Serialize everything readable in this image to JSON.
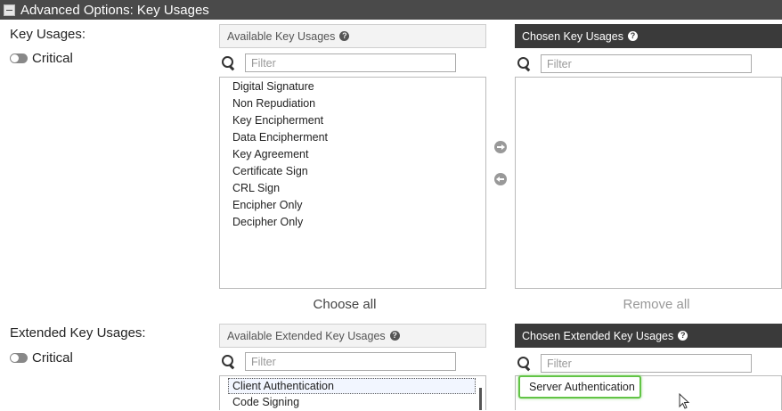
{
  "section": {
    "title": "Advanced Options: Key Usages",
    "collapse_icon": "minus-square-icon"
  },
  "key_usages": {
    "label": "Key Usages:",
    "critical_label": "Critical",
    "critical_on": false,
    "available": {
      "header": "Available Key Usages",
      "help_glyph": "?",
      "filter_placeholder": "Filter",
      "items": [
        "Digital Signature",
        "Non Repudiation",
        "Key Encipherment",
        "Data Encipherment",
        "Key Agreement",
        "Certificate Sign",
        "CRL Sign",
        "Encipher Only",
        "Decipher Only"
      ],
      "action": "Choose all"
    },
    "chosen": {
      "header": "Chosen Key Usages",
      "help_glyph": "?",
      "filter_placeholder": "Filter",
      "items": [],
      "action": "Remove all"
    }
  },
  "extended_key_usages": {
    "label": "Extended Key Usages:",
    "critical_label": "Critical",
    "critical_on": false,
    "available": {
      "header": "Available Extended Key Usages",
      "help_glyph": "?",
      "filter_placeholder": "Filter",
      "items": [
        "Client Authentication",
        "Code Signing"
      ]
    },
    "chosen": {
      "header": "Chosen Extended Key Usages",
      "help_glyph": "?",
      "filter_placeholder": "Filter",
      "items": [
        "Server Authentication"
      ]
    }
  },
  "colors": {
    "header_bg": "#4a4a4a",
    "dark_panel": "#3a3a3a",
    "highlight": "#62c446"
  }
}
